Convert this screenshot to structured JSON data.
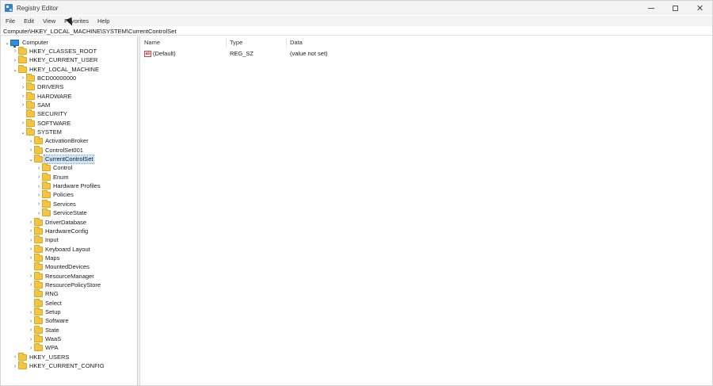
{
  "window": {
    "title": "Registry Editor",
    "controls": {
      "minimize": "—",
      "maximize": "☐",
      "close": "✕"
    }
  },
  "menu": {
    "items": [
      "File",
      "Edit",
      "View",
      "Favorites",
      "Help"
    ]
  },
  "address": {
    "path": "Computer\\HKEY_LOCAL_MACHINE\\SYSTEM\\CurrentControlSet"
  },
  "tree": [
    {
      "label": "Computer",
      "depth": 0,
      "expanded": true,
      "icon": "computer-icon"
    },
    {
      "label": "HKEY_CLASSES_ROOT",
      "depth": 1,
      "expanded": false,
      "icon": "folder-icon"
    },
    {
      "label": "HKEY_CURRENT_USER",
      "depth": 1,
      "expanded": false,
      "icon": "folder-icon"
    },
    {
      "label": "HKEY_LOCAL_MACHINE",
      "depth": 1,
      "expanded": true,
      "icon": "folder-icon"
    },
    {
      "label": "BCD00000000",
      "depth": 2,
      "expanded": false,
      "icon": "folder-icon"
    },
    {
      "label": "DRIVERS",
      "depth": 2,
      "expanded": false,
      "icon": "folder-icon"
    },
    {
      "label": "HARDWARE",
      "depth": 2,
      "expanded": false,
      "icon": "folder-icon"
    },
    {
      "label": "SAM",
      "depth": 2,
      "expanded": false,
      "icon": "folder-icon"
    },
    {
      "label": "SECURITY",
      "depth": 2,
      "expanded": null,
      "icon": "folder-icon"
    },
    {
      "label": "SOFTWARE",
      "depth": 2,
      "expanded": false,
      "icon": "folder-icon"
    },
    {
      "label": "SYSTEM",
      "depth": 2,
      "expanded": true,
      "icon": "folder-icon"
    },
    {
      "label": "ActivationBroker",
      "depth": 3,
      "expanded": false,
      "icon": "folder-icon"
    },
    {
      "label": "ControlSet001",
      "depth": 3,
      "expanded": false,
      "icon": "folder-icon"
    },
    {
      "label": "CurrentControlSet",
      "depth": 3,
      "expanded": true,
      "icon": "folder-icon",
      "selected": true
    },
    {
      "label": "Control",
      "depth": 4,
      "expanded": false,
      "icon": "folder-icon"
    },
    {
      "label": "Enum",
      "depth": 4,
      "expanded": false,
      "icon": "folder-icon"
    },
    {
      "label": "Hardware Profiles",
      "depth": 4,
      "expanded": false,
      "icon": "folder-icon"
    },
    {
      "label": "Policies",
      "depth": 4,
      "expanded": false,
      "icon": "folder-icon"
    },
    {
      "label": "Services",
      "depth": 4,
      "expanded": false,
      "icon": "folder-icon"
    },
    {
      "label": "ServiceState",
      "depth": 4,
      "expanded": false,
      "icon": "folder-icon"
    },
    {
      "label": "DriverDatabase",
      "depth": 3,
      "expanded": false,
      "icon": "folder-icon"
    },
    {
      "label": "HardwareConfig",
      "depth": 3,
      "expanded": false,
      "icon": "folder-icon"
    },
    {
      "label": "Input",
      "depth": 3,
      "expanded": false,
      "icon": "folder-icon"
    },
    {
      "label": "Keyboard Layout",
      "depth": 3,
      "expanded": false,
      "icon": "folder-icon"
    },
    {
      "label": "Maps",
      "depth": 3,
      "expanded": false,
      "icon": "folder-icon"
    },
    {
      "label": "MountedDevices",
      "depth": 3,
      "expanded": null,
      "icon": "folder-icon"
    },
    {
      "label": "ResourceManager",
      "depth": 3,
      "expanded": false,
      "icon": "folder-icon"
    },
    {
      "label": "ResourcePolicyStore",
      "depth": 3,
      "expanded": false,
      "icon": "folder-icon"
    },
    {
      "label": "RNG",
      "depth": 3,
      "expanded": null,
      "icon": "folder-icon"
    },
    {
      "label": "Select",
      "depth": 3,
      "expanded": null,
      "icon": "folder-icon"
    },
    {
      "label": "Setup",
      "depth": 3,
      "expanded": false,
      "icon": "folder-icon"
    },
    {
      "label": "Software",
      "depth": 3,
      "expanded": false,
      "icon": "folder-icon"
    },
    {
      "label": "State",
      "depth": 3,
      "expanded": false,
      "icon": "folder-icon"
    },
    {
      "label": "WaaS",
      "depth": 3,
      "expanded": false,
      "icon": "folder-icon"
    },
    {
      "label": "WPA",
      "depth": 3,
      "expanded": false,
      "icon": "folder-icon"
    },
    {
      "label": "HKEY_USERS",
      "depth": 1,
      "expanded": false,
      "icon": "folder-icon"
    },
    {
      "label": "HKEY_CURRENT_CONFIG",
      "depth": 1,
      "expanded": false,
      "icon": "folder-icon"
    }
  ],
  "list": {
    "columns": {
      "name": "Name",
      "type": "Type",
      "data": "Data"
    },
    "rows": [
      {
        "name": "(Default)",
        "type": "REG_SZ",
        "data": "(value not set)",
        "icon": "ab"
      }
    ]
  },
  "colors": {
    "selection": "#cce4f7",
    "folder": "#f4c542",
    "computer": "#2d8fd9"
  }
}
